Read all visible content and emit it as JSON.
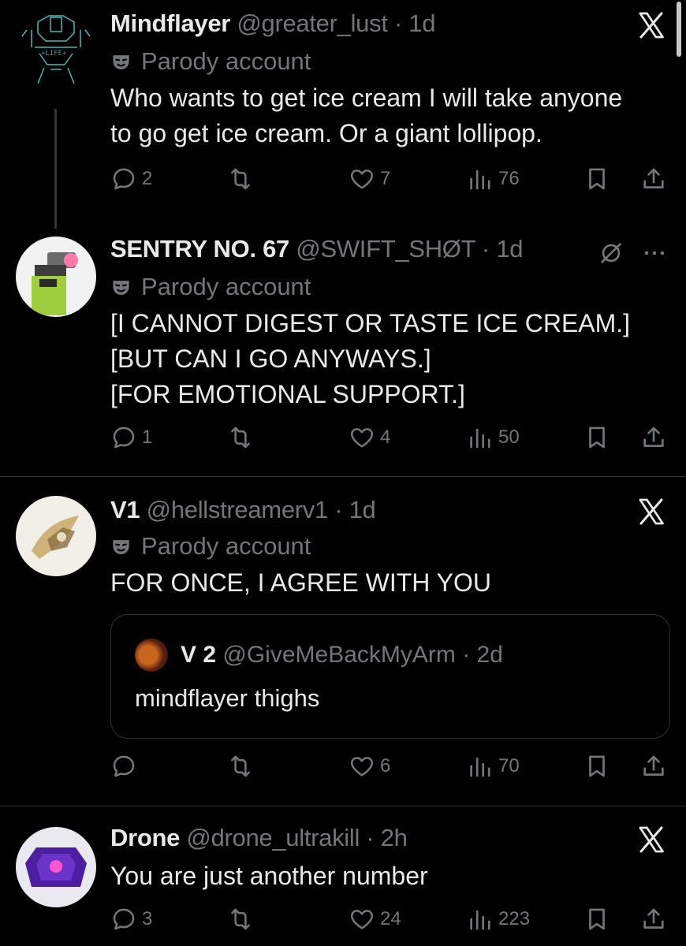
{
  "tweets": [
    {
      "name": "Mindflayer",
      "handle": "@greater_lust",
      "time": "· 1d",
      "label": "Parody account",
      "text": [
        "Who wants to get ice cream I will take anyone",
        "to go get ice cream. Or a giant lollipop."
      ],
      "replies": "2",
      "retweets": "",
      "likes": "7",
      "views": "76"
    },
    {
      "name": "SENTRY NO. 67",
      "handle": "@SWIFT_SHØT",
      "time": "· 1d",
      "label": "Parody account",
      "text": [
        "[I CANNOT DIGEST OR TASTE ICE CREAM.]",
        "[BUT CAN I GO ANYWAYS.]",
        "[FOR EMOTIONAL SUPPORT.]"
      ],
      "replies": "1",
      "retweets": "",
      "likes": "4",
      "views": "50"
    },
    {
      "name": "V1",
      "handle": "@hellstreamerv1",
      "time": "· 1d",
      "label": "Parody account",
      "text": [
        "FOR ONCE, I AGREE WITH YOU"
      ],
      "quote": {
        "name": "V 2",
        "handle": "@GiveMeBackMyArm",
        "time": "· 2d",
        "text": "mindflayer thighs"
      },
      "replies": "",
      "retweets": "",
      "likes": "6",
      "views": "70"
    },
    {
      "name": "Drone",
      "handle": "@drone_ultrakill",
      "time": "· 2h",
      "text": [
        "You are just another number"
      ],
      "replies": "3",
      "retweets": "",
      "likes": "24",
      "views": "223"
    }
  ],
  "colors": {
    "background": "#000000",
    "text": "#e7e9ea",
    "muted": "#71767b",
    "border": "#2f3336"
  },
  "icons": [
    "x-logo-icon",
    "parody-mask-icon",
    "reply-icon",
    "retweet-icon",
    "like-icon",
    "views-icon",
    "bookmark-icon",
    "share-icon",
    "more-icon",
    "no-notify-icon"
  ]
}
